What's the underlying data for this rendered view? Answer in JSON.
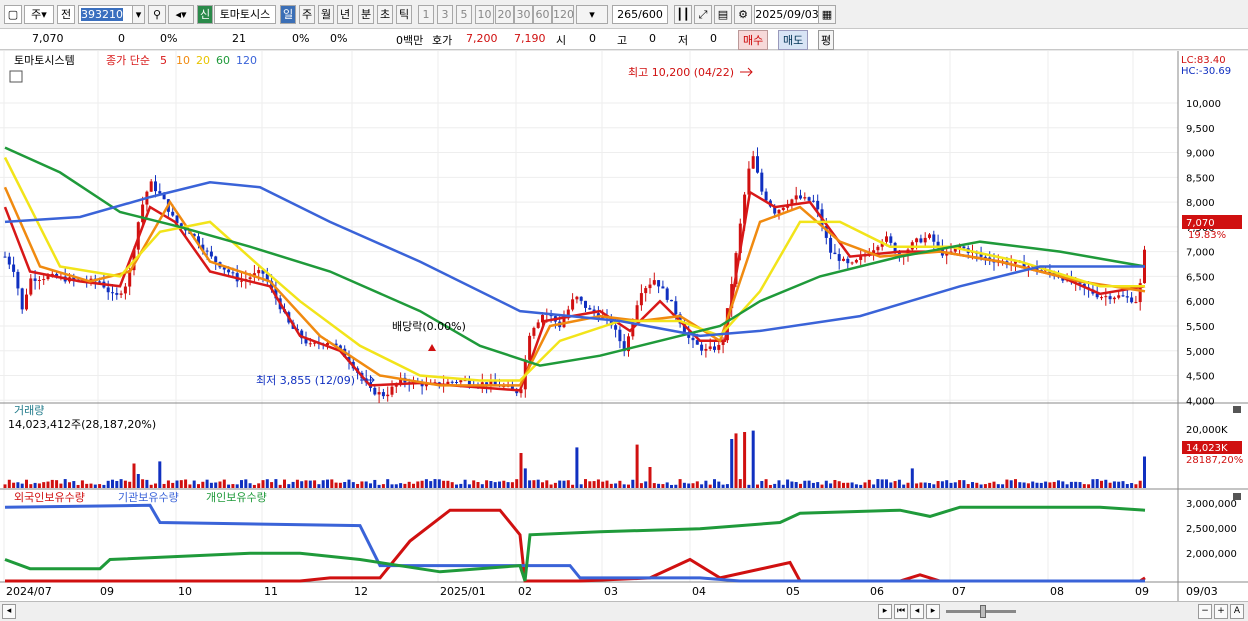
{
  "toolbar": {
    "market_label": "주",
    "prev_label": "전",
    "code": "393210",
    "new_label": "신",
    "stock_name": "토마토시스",
    "periods": [
      "일",
      "주",
      "월",
      "년",
      "분",
      "초",
      "틱"
    ],
    "active_period": "일",
    "intervals": [
      "1",
      "3",
      "5",
      "10",
      "20",
      "30",
      "60",
      "120"
    ],
    "count": "265",
    "count_total": "/600",
    "date": "2025/09/03"
  },
  "infobar": {
    "price": "7,070",
    "change": "0",
    "change_pct": "0%",
    "volume": "21",
    "vol_pct1": "0%",
    "vol_pct2": "0%",
    "amount": "0백만",
    "quote_label": "호가",
    "ask": "7,200",
    "bid": "7,190",
    "open_label": "시",
    "open": "0",
    "high_label": "고",
    "high": "0",
    "low_label": "저",
    "low": "0",
    "buy_label": "매수",
    "sell_label": "매도",
    "eval_label": "평"
  },
  "price_panel": {
    "name": "토마토시스템",
    "ma_label": "종가 단순",
    "ma_periods": [
      "5",
      "10",
      "20",
      "60",
      "120"
    ],
    "lc": "LC:83.40",
    "hc": "HC:-30.69",
    "current_price_tag": "7,070",
    "current_pct_tag": "19.83%",
    "high_annot": "최고 10,200 (04/22)",
    "low_annot": "최저 3,855 (12/09)",
    "dividend_annot": "배당락(0.00%)",
    "y_ticks": [
      "10,000",
      "9,500",
      "9,000",
      "8,500",
      "8,000",
      "7,500",
      "7,000",
      "6,500",
      "6,000",
      "5,500",
      "5,000",
      "4,500",
      "4,000"
    ]
  },
  "volume_panel": {
    "title": "거래량",
    "value": "14,023,412주(28,187,20%)",
    "y_ticks": [
      "20,000K"
    ],
    "tag1": "14,023K",
    "tag2": "28187,20%"
  },
  "holdings_panel": {
    "series": [
      "외국인보유수량",
      "기관보유수량",
      "개인보유수량"
    ],
    "y_ticks": [
      "3,000,000",
      "2,500,000",
      "2,000,000"
    ]
  },
  "x_axis": {
    "labels": [
      "2024/07",
      "09",
      "10",
      "11",
      "12",
      "2025/01",
      "02",
      "03",
      "04",
      "05",
      "06",
      "07",
      "08",
      "09"
    ],
    "right_label": "09/03"
  },
  "colors": {
    "up": "#d01010",
    "down": "#1030c0",
    "ma5": "#d81818",
    "ma10": "#f08a10",
    "ma20": "#f2e41a",
    "ma60": "#1f9a3a",
    "ma120": "#3a63d8"
  }
}
